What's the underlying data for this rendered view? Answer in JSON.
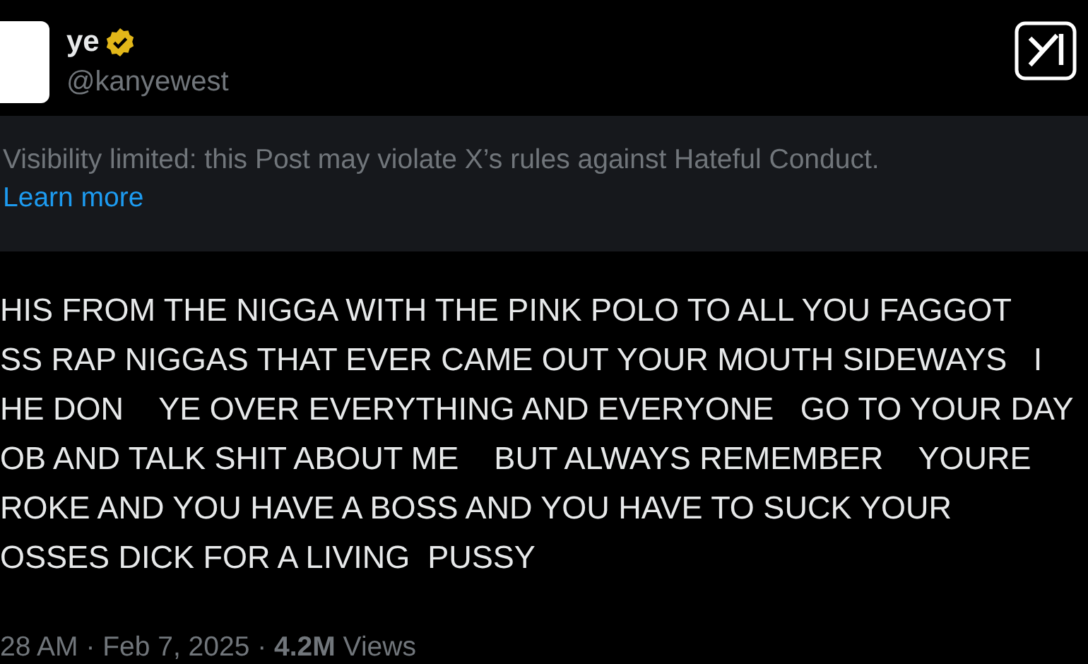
{
  "author": {
    "name": "ye",
    "verified": true,
    "handle": "@kanyewest"
  },
  "notice": {
    "text": "Visibility limited: this Post may violate X’s rules against Hateful Conduct.",
    "link": "Learn more"
  },
  "post_lines": [
    "HIS FROM THE NIGGA WITH THE PINK POLO TO ALL YOU FAGGOT",
    "SS RAP NIGGAS THAT EVER CAME OUT YOUR MOUTH SIDEWAYS   I",
    "HE DON    YE OVER EVERYTHING AND EVERYONE   GO TO YOUR DAY",
    "OB AND TALK SHIT ABOUT ME    BUT ALWAYS REMEMBER    YOURE",
    "ROKE AND YOU HAVE A BOSS AND YOU HAVE TO SUCK YOUR",
    "OSSES DICK FOR A LIVING  PUSSY"
  ],
  "meta": "28 AM · Feb 7, 2025 · **4.2M** Views"
}
